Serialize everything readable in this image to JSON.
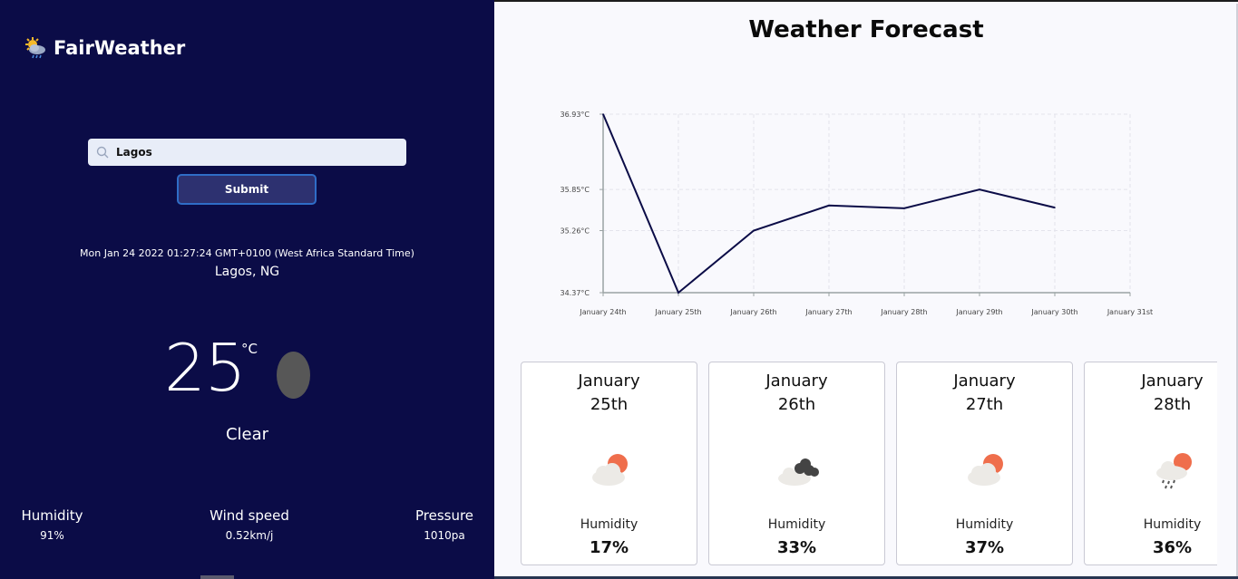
{
  "brand": {
    "name": "FairWeather",
    "logo_icon": "sun-cloud-rain-icon"
  },
  "search": {
    "value": "Lagos",
    "icon": "search-icon"
  },
  "submit_label": "Submit",
  "current": {
    "datetime": "Mon Jan 24 2022 01:27:24 GMT+0100 (West Africa Standard Time)",
    "location": "Lagos, NG",
    "temperature": "25",
    "unit": "°C",
    "condition": "Clear",
    "icon": "moon-icon"
  },
  "stats": {
    "humidity_label": "Humidity",
    "humidity_value": "91%",
    "wind_label": "Wind speed",
    "wind_value": "0.52km/j",
    "pressure_label": "Pressure",
    "pressure_value": "1010pa"
  },
  "forecast": {
    "title": "Weather Forecast",
    "cards": [
      {
        "date_line1": "January",
        "date_line2": "25th",
        "icon": "partly-sunny-icon",
        "humidity_label": "Humidity",
        "humidity_value": "17%"
      },
      {
        "date_line1": "January",
        "date_line2": "26th",
        "icon": "dark-clouds-icon",
        "humidity_label": "Humidity",
        "humidity_value": "33%"
      },
      {
        "date_line1": "January",
        "date_line2": "27th",
        "icon": "partly-sunny-icon",
        "humidity_label": "Humidity",
        "humidity_value": "37%"
      },
      {
        "date_line1": "January",
        "date_line2": "28th",
        "icon": "rain-sun-icon",
        "humidity_label": "Humidity",
        "humidity_value": "36%"
      }
    ]
  },
  "chart_data": {
    "type": "line",
    "x": [
      "January 24th",
      "January 25th",
      "January 26th",
      "January 27th",
      "January 28th",
      "January 29th",
      "January 30th",
      "January 31st"
    ],
    "y_ticks": [
      "36.93°C",
      "35.85°C",
      "35.26°C",
      "34.37°C"
    ],
    "y_tick_values": [
      36.93,
      35.85,
      35.26,
      34.37
    ],
    "ylim": [
      34.37,
      36.93
    ],
    "series": [
      {
        "values": [
          36.93,
          34.37,
          35.26,
          35.62,
          35.58,
          35.85,
          35.59
        ],
        "color": "#0b0c47"
      }
    ],
    "grid": true
  }
}
